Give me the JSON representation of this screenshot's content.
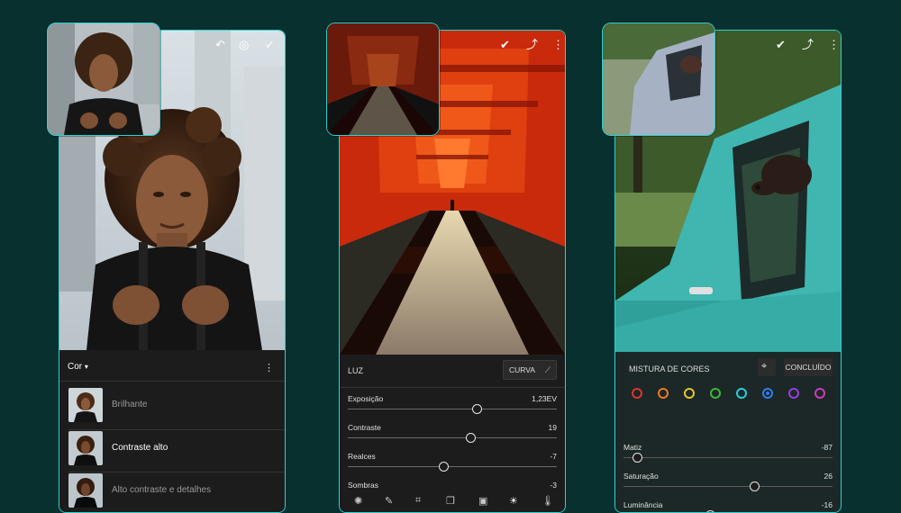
{
  "colors": {
    "background": "#08302f",
    "accent": "#2bd3cf",
    "panel": "#1c1c1c"
  },
  "left_phone": {
    "top_icons": [
      "undo-icon",
      "heal-icon",
      "check-icon"
    ],
    "panel_title": "Cor",
    "presets": [
      {
        "label": "Brilhante",
        "selected": false
      },
      {
        "label": "Contraste alto",
        "selected": true
      },
      {
        "label": "Alto contraste e detalhes",
        "selected": false
      }
    ]
  },
  "middle_phone": {
    "top_icons": [
      "check-circle-icon",
      "share-icon",
      "more-icon"
    ],
    "section_title": "LUZ",
    "curve_button": "CURVA",
    "sliders": [
      {
        "label": "Exposição",
        "value": "1,23EV",
        "position": 0.62
      },
      {
        "label": "Contraste",
        "value": "19",
        "position": 0.59
      },
      {
        "label": "Realces",
        "value": "-7",
        "position": 0.46
      },
      {
        "label": "Sombras",
        "value": "-3"
      }
    ],
    "toolbar": [
      "presets-icon",
      "brush-icon",
      "crop-icon",
      "layers-icon",
      "image-icon",
      "light-icon",
      "temperature-icon"
    ]
  },
  "right_phone": {
    "top_icons": [
      "check-circle-icon",
      "share-icon",
      "more-icon"
    ],
    "section_title": "MISTURA DE CORES",
    "done_button": "CONCLUÍDO",
    "color_dots": [
      {
        "name": "red",
        "color": "#e0342f"
      },
      {
        "name": "orange",
        "color": "#ee7a22"
      },
      {
        "name": "yellow",
        "color": "#e9c42a"
      },
      {
        "name": "green",
        "color": "#3fb43a"
      },
      {
        "name": "aqua",
        "color": "#2ccde0"
      },
      {
        "name": "blue",
        "color": "#2f7de8"
      },
      {
        "name": "purple",
        "color": "#9a3fe0"
      },
      {
        "name": "magenta",
        "color": "#d13ab8"
      }
    ],
    "selected_color": "blue",
    "sliders": [
      {
        "label": "Matiz",
        "value": "-87",
        "position": 0.07
      },
      {
        "label": "Saturação",
        "value": "26",
        "position": 0.63
      },
      {
        "label": "Luminância",
        "value": "-16",
        "position": 0.42
      }
    ]
  }
}
